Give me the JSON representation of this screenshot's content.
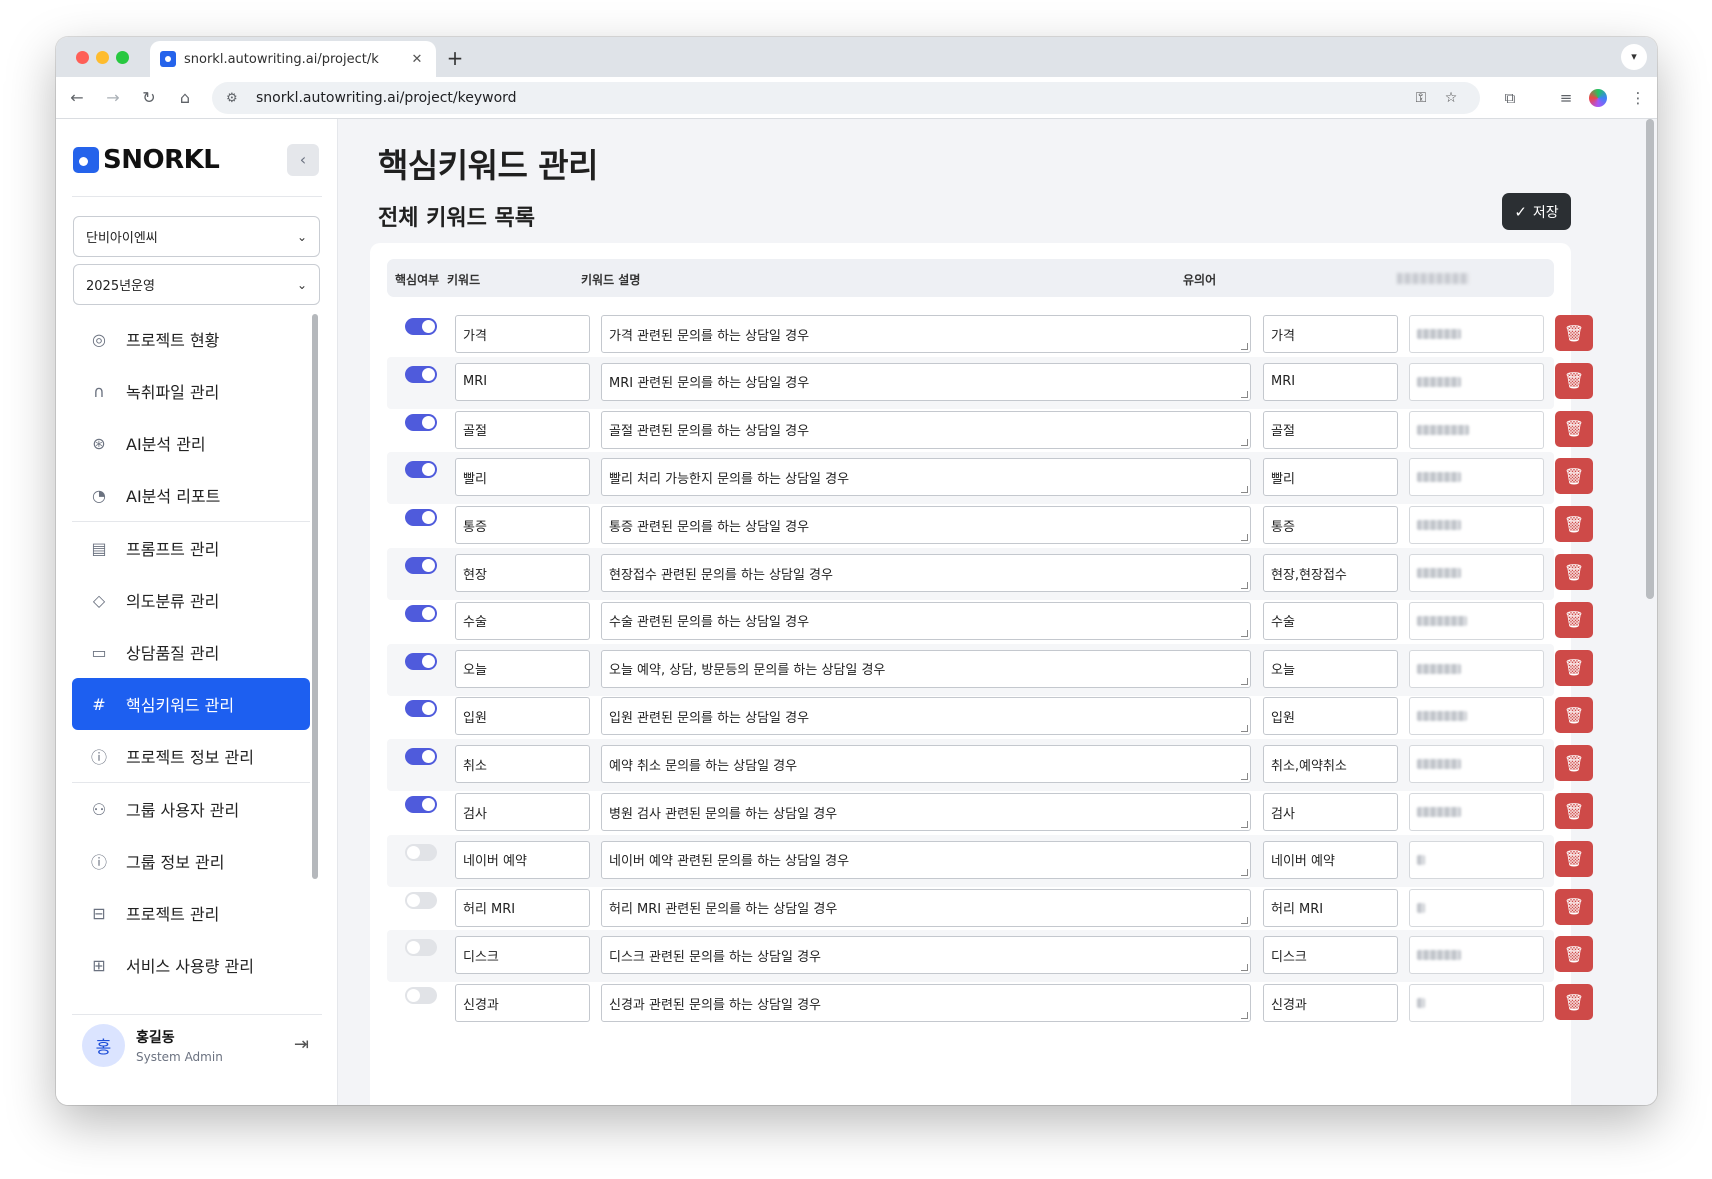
{
  "browser": {
    "tab_title": "snorkl.autowriting.ai/project/k",
    "url": "snorkl.autowriting.ai/project/keyword"
  },
  "sidebar": {
    "logo": "SNORKL",
    "select_company": "단비아이엔씨",
    "select_period": "2025년운영",
    "items": [
      {
        "label": "프로젝트 현황",
        "icon": "globe-icon"
      },
      {
        "label": "녹취파일 관리",
        "icon": "headphones-icon"
      },
      {
        "label": "AI분석 관리",
        "icon": "lifebuoy-icon"
      },
      {
        "label": "AI분석 리포트",
        "icon": "pie-chart-icon"
      },
      {
        "label": "프롬프트 관리",
        "icon": "document-icon"
      },
      {
        "label": "의도분류 관리",
        "icon": "tag-icon"
      },
      {
        "label": "상담품질 관리",
        "icon": "chat-icon"
      },
      {
        "label": "핵심키워드 관리",
        "icon": "hash-icon"
      },
      {
        "label": "프로젝트 정보 관리",
        "icon": "info-icon"
      },
      {
        "label": "그룹 사용자 관리",
        "icon": "users-icon"
      },
      {
        "label": "그룹 정보 관리",
        "icon": "info-icon"
      },
      {
        "label": "프로젝트 관리",
        "icon": "briefcase-icon"
      },
      {
        "label": "서비스 사용량 관리",
        "icon": "grid-icon"
      }
    ],
    "active_index": 7,
    "user": {
      "initial": "홍",
      "name": "홍길동",
      "role": "System Admin"
    }
  },
  "main": {
    "title": "핵심키워드 관리",
    "section": "전체 키워드 목록",
    "save_label": "저장",
    "columns": [
      "핵심여부",
      "키워드",
      "키워드 설명",
      "유의어"
    ],
    "rows": [
      {
        "on": true,
        "keyword": "가격",
        "desc": "가격 관련된 문의를 하는 상담일 경우",
        "synonym": "가격"
      },
      {
        "on": true,
        "keyword": "MRI",
        "desc": "MRI 관련된 문의를 하는 상담일 경우",
        "synonym": "MRI"
      },
      {
        "on": true,
        "keyword": "골절",
        "desc": "골절 관련된 문의를 하는 상담일 경우",
        "synonym": "골절"
      },
      {
        "on": true,
        "keyword": "빨리",
        "desc": "빨리 처리 가능한지 문의를 하는 상담일 경우",
        "synonym": "빨리"
      },
      {
        "on": true,
        "keyword": "통증",
        "desc": "통증 관련된 문의를 하는 상담일 경우",
        "synonym": "통증"
      },
      {
        "on": true,
        "keyword": "현장",
        "desc": "현장접수 관련된 문의를 하는 상담일 경우",
        "synonym": "현장,현장접수"
      },
      {
        "on": true,
        "keyword": "수술",
        "desc": "수술 관련된 문의를 하는 상담일 경우",
        "synonym": "수술"
      },
      {
        "on": true,
        "keyword": "오늘",
        "desc": "오늘 예약, 상담, 방문등의 문의를 하는 상담일 경우",
        "synonym": "오늘"
      },
      {
        "on": true,
        "keyword": "입원",
        "desc": "입원 관련된 문의를 하는 상담일 경우",
        "synonym": "입원"
      },
      {
        "on": true,
        "keyword": "취소",
        "desc": "예약 취소 문의를 하는 상담일 경우",
        "synonym": "취소,예약취소"
      },
      {
        "on": true,
        "keyword": "검사",
        "desc": "병원 검사 관련된 문의를 하는 상담일 경우",
        "synonym": "검사"
      },
      {
        "on": false,
        "keyword": "네이버 예약",
        "desc": "네이버 예약 관련된 문의를 하는 상담일 경우",
        "synonym": "네이버 예약"
      },
      {
        "on": false,
        "keyword": "허리 MRI",
        "desc": "허리 MRI 관련된 문의를 하는 상담일 경우",
        "synonym": "허리 MRI"
      },
      {
        "on": false,
        "keyword": "디스크",
        "desc": "디스크 관련된 문의를 하는 상담일 경우",
        "synonym": "디스크"
      },
      {
        "on": false,
        "keyword": "신경과",
        "desc": "신경과 관련된 문의를 하는 상담일 경우",
        "synonym": "신경과"
      }
    ]
  },
  "colors": {
    "accent": "#1d5ff0",
    "toggle_on": "#4f5bdc",
    "delete": "#ce4a48",
    "save": "#2b2f33"
  }
}
